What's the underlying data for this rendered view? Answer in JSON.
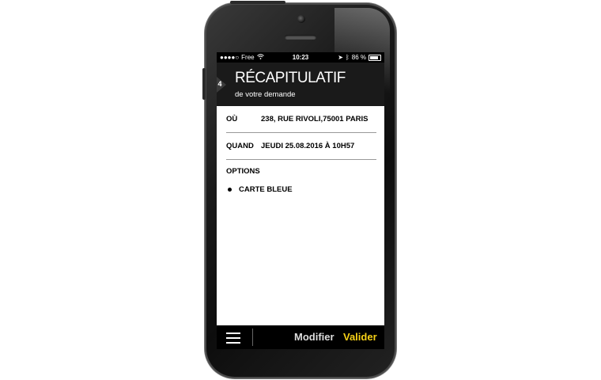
{
  "status_bar": {
    "carrier": "Free",
    "time": "10:23",
    "battery": "86 %"
  },
  "header": {
    "step": "4",
    "title": "RÉCAPITULATIF",
    "subtitle": "de votre demande"
  },
  "summary": {
    "where_label": "OÙ",
    "where_value": "238, RUE RIVOLI,75001 PARIS",
    "when_label": "QUAND",
    "when_value": "JEUDI 25.08.2016 À 10H57",
    "options_title": "OPTIONS",
    "options": [
      "CARTE BLEUE"
    ]
  },
  "bottom_bar": {
    "modify_label": "Modifier",
    "validate_label": "Valider"
  },
  "colors": {
    "accent": "#f7d117",
    "header_bg": "#1a1a1a"
  }
}
